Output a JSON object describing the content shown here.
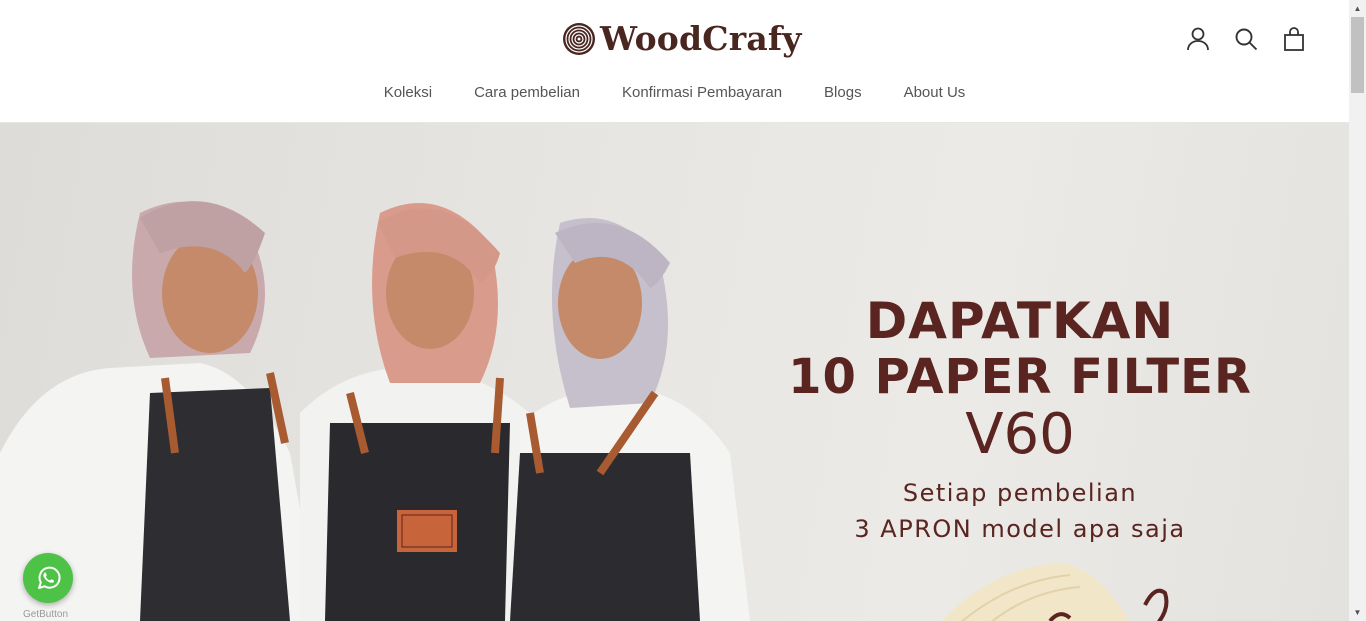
{
  "header": {
    "brand": "WoodCrafy",
    "icons": [
      "account-icon",
      "search-icon",
      "cart-icon"
    ]
  },
  "nav": {
    "items": [
      {
        "label": "Koleksi"
      },
      {
        "label": "Cara pembelian"
      },
      {
        "label": "Konfirmasi Pembayaran"
      },
      {
        "label": "Blogs"
      },
      {
        "label": "About Us"
      }
    ]
  },
  "hero": {
    "line1": "DAPATKAN",
    "line2": "10 PAPER FILTER",
    "line3": "V60",
    "sub1": "Setiap pembelian",
    "sub2": "3 APRON model apa saja",
    "text_color": "#5a2420"
  },
  "widget": {
    "label": "GetButton",
    "color": "#4dc247",
    "icon": "whatsapp-icon"
  },
  "colors": {
    "brand": "#4a2620",
    "nav_text": "#555555"
  }
}
